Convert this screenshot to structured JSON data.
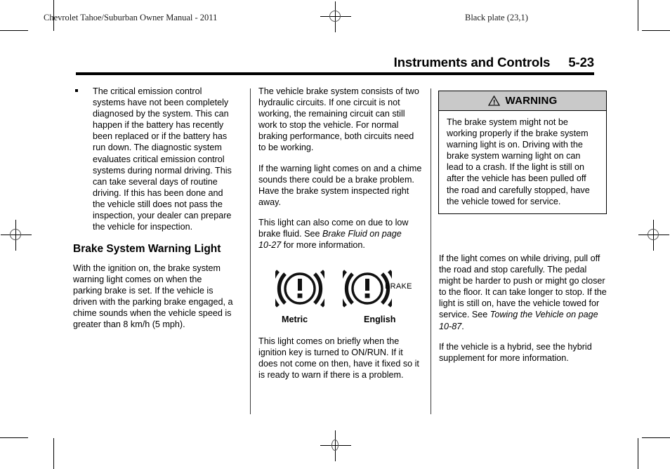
{
  "page": {
    "manual_title": "Chevrolet Tahoe/Suburban Owner Manual - 2011",
    "black_plate": "Black plate (23,1)",
    "section_title": "Instruments and Controls",
    "folio": "5-23"
  },
  "column_1": {
    "bullets": [
      "The critical emission control systems have not been completely diagnosed by the system. This can happen if the battery has recently been replaced or if the battery has run down. The diagnostic system evaluates critical emission control systems during normal driving. This can take several days of routine driving. If this has been done and the vehicle still does not pass the inspection, your dealer can prepare the vehicle for inspection."
    ],
    "heading": "Brake System Warning Light",
    "body": "With the ignition on, the brake system warning light comes on when the parking brake is set. If the vehicle is driven with the parking brake engaged, a chime sounds when the vehicle speed is greater than 8 km/h (5 mph)."
  },
  "column_2": {
    "paragraph_1": "The vehicle brake system consists of two hydraulic circuits. If one circuit is not working, the remaining circuit can still work to stop the vehicle. For normal braking performance, both circuits need to be working.",
    "paragraph_2": "If the warning light comes on and a chime sounds there could be a brake problem. Have the brake system inspected right away.",
    "paragraph_3_pre": "This light can also come on due to low brake fluid. See ",
    "paragraph_3_xref": "Brake Fluid on page 10‑27",
    "paragraph_3_post": " for more information.",
    "figure": {
      "metric_caption": "Metric",
      "english_caption": "English",
      "english_label": "BRAKE",
      "metric_icon_name": "brake-warning-symbol-metric",
      "english_icon_name": "brake-warning-symbol-english"
    },
    "paragraph_4": "This light comes on briefly when the ignition key is turned to ON/RUN. If it does not come on then, have it fixed so it is ready to warn if there is a problem."
  },
  "column_3": {
    "warning": {
      "label": "WARNING",
      "icon": "warning-triangle-icon",
      "body": "The brake system might not be working properly if the brake system warning light is on. Driving with the brake system warning light on can lead to a crash. If the light is still on after the vehicle has been pulled off the road and carefully stopped, have the vehicle towed for service."
    },
    "paragraph_1_pre": "If the light comes on while driving, pull off the road and stop carefully. The pedal might be harder to push or might go closer to the floor. It can take longer to stop. If the light is still on, have the vehicle towed for service. See ",
    "paragraph_1_xref": "Towing the Vehicle on page 10‑87",
    "paragraph_1_post": ".",
    "paragraph_2": "If the vehicle is a hybrid, see the hybrid supplement for more information."
  },
  "colors": {
    "warning_header_bg": "#c9c9c9",
    "rule": "#000000",
    "text": "#000000"
  }
}
